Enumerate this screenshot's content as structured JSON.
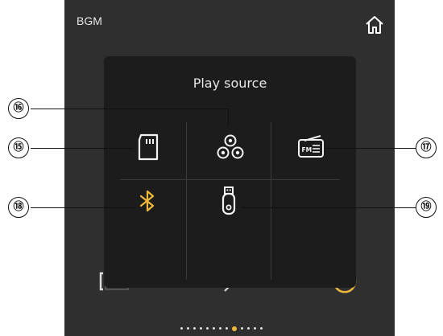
{
  "header": {
    "title": "BGM"
  },
  "modal": {
    "title": "Play source",
    "sources": [
      {
        "name": "sd-card",
        "icon": "sd-card-icon"
      },
      {
        "name": "multi-source",
        "icon": "multi-circle-icon"
      },
      {
        "name": "fm-radio",
        "icon": "fm-radio-icon",
        "label": "FM"
      },
      {
        "name": "bluetooth",
        "icon": "bluetooth-icon",
        "active": true
      },
      {
        "name": "usb",
        "icon": "usb-drive-icon"
      }
    ]
  },
  "callouts": {
    "n15": "⑮",
    "n16": "⑯",
    "n17": "⑰",
    "n18": "⑱",
    "n19": "⑲"
  },
  "pager": {
    "count": 13,
    "active_index": 8
  },
  "colors": {
    "panel_bg": "#2f2f2f",
    "modal_bg": "#1c1c1c",
    "accent": "#f0b83b",
    "icon": "#f2f2f2"
  }
}
